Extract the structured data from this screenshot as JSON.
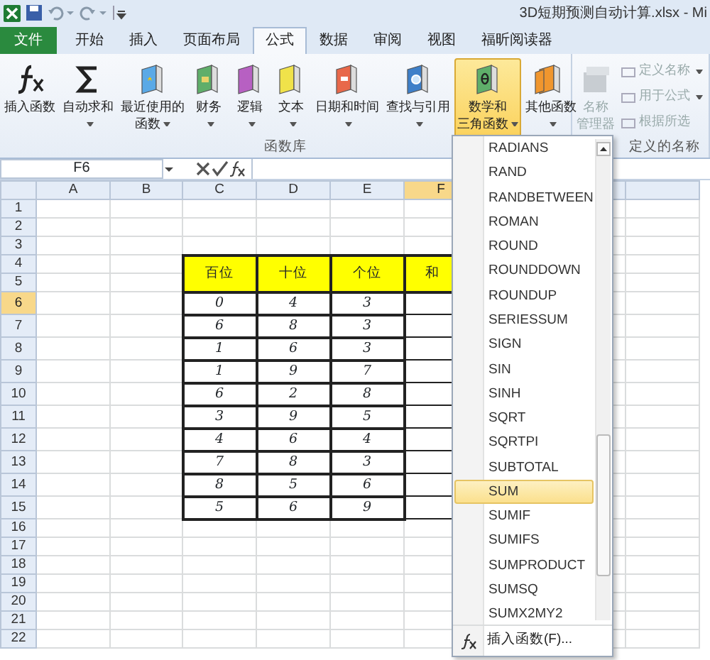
{
  "window": {
    "title": "3D短期预测自动计算.xlsx - Mi"
  },
  "tabs": [
    {
      "label": "文件",
      "kind": "file",
      "selected": false
    },
    {
      "label": "开始",
      "kind": "tab",
      "selected": false
    },
    {
      "label": "插入",
      "kind": "tab",
      "selected": false
    },
    {
      "label": "页面布局",
      "kind": "tab",
      "selected": false
    },
    {
      "label": "公式",
      "kind": "tab",
      "selected": true
    },
    {
      "label": "数据",
      "kind": "tab",
      "selected": false
    },
    {
      "label": "审阅",
      "kind": "tab",
      "selected": false
    },
    {
      "label": "视图",
      "kind": "tab",
      "selected": false
    },
    {
      "label": "福昕阅读器",
      "kind": "tab",
      "selected": false
    }
  ],
  "ribbon_groups": [
    {
      "label": "函数库",
      "buttons": [
        {
          "lines": [
            "插入函数"
          ],
          "dropdown": false,
          "selected": false,
          "disabled": false
        },
        {
          "lines": [
            "自动求和"
          ],
          "dropdown": true,
          "selected": false,
          "disabled": false
        },
        {
          "lines": [
            "最近使用的",
            "函数"
          ],
          "dropdown": true,
          "selected": false,
          "disabled": false
        },
        {
          "lines": [
            "财务"
          ],
          "dropdown": true,
          "selected": false,
          "disabled": false
        },
        {
          "lines": [
            "逻辑"
          ],
          "dropdown": true,
          "selected": false,
          "disabled": false
        },
        {
          "lines": [
            "文本"
          ],
          "dropdown": true,
          "selected": false,
          "disabled": false
        },
        {
          "lines": [
            "日期和时间"
          ],
          "dropdown": true,
          "selected": false,
          "disabled": false
        },
        {
          "lines": [
            "查找与引用"
          ],
          "dropdown": true,
          "selected": false,
          "disabled": false
        },
        {
          "lines": [
            "数学和",
            "三角函数"
          ],
          "dropdown": true,
          "selected": true,
          "disabled": false
        },
        {
          "lines": [
            "其他函数"
          ],
          "dropdown": true,
          "selected": false,
          "disabled": false
        }
      ]
    },
    {
      "label": "定义的名称",
      "buttons": [
        {
          "lines": [
            "名称",
            "管理器"
          ],
          "dropdown": false,
          "selected": false,
          "disabled": true
        }
      ],
      "small_buttons": [
        {
          "label": "定义名称",
          "dropdown": true,
          "disabled": true
        },
        {
          "label": "用于公式",
          "dropdown": true,
          "disabled": true
        },
        {
          "label": "根据所选",
          "dropdown": false,
          "disabled": true
        }
      ]
    }
  ],
  "formula_bar": {
    "name_box": "F6"
  },
  "sheet": {
    "columns": [
      {
        "label": "A",
        "selected": false
      },
      {
        "label": "B",
        "selected": false
      },
      {
        "label": "C",
        "selected": false
      },
      {
        "label": "D",
        "selected": false
      },
      {
        "label": "E",
        "selected": false
      },
      {
        "label": "F",
        "selected": true
      }
    ],
    "rows": [
      {
        "label": "1",
        "selected": false
      },
      {
        "label": "2",
        "selected": false
      },
      {
        "label": "3",
        "selected": false
      },
      {
        "label": "4",
        "selected": false
      },
      {
        "label": "5",
        "selected": false
      },
      {
        "label": "6",
        "selected": true
      },
      {
        "label": "7",
        "selected": false
      },
      {
        "label": "8",
        "selected": false
      },
      {
        "label": "9",
        "selected": false
      },
      {
        "label": "10",
        "selected": false
      },
      {
        "label": "11",
        "selected": false
      },
      {
        "label": "12",
        "selected": false
      },
      {
        "label": "13",
        "selected": false
      },
      {
        "label": "14",
        "selected": false
      },
      {
        "label": "15",
        "selected": false
      },
      {
        "label": "16",
        "selected": false
      },
      {
        "label": "17",
        "selected": false
      },
      {
        "label": "18",
        "selected": false
      },
      {
        "label": "19",
        "selected": false
      },
      {
        "label": "20",
        "selected": false
      },
      {
        "label": "21",
        "selected": false
      },
      {
        "label": "22",
        "selected": false
      }
    ],
    "table_header": [
      "百位",
      "十位",
      "个位",
      "和"
    ],
    "table_rows": [
      [
        "0",
        "4",
        "3"
      ],
      [
        "6",
        "8",
        "3"
      ],
      [
        "1",
        "6",
        "3"
      ],
      [
        "1",
        "9",
        "7"
      ],
      [
        "6",
        "2",
        "8"
      ],
      [
        "3",
        "9",
        "5"
      ],
      [
        "4",
        "6",
        "4"
      ],
      [
        "7",
        "8",
        "3"
      ],
      [
        "8",
        "5",
        "6"
      ],
      [
        "5",
        "6",
        "9"
      ]
    ]
  },
  "menu": {
    "items": [
      {
        "label": "RADIANS",
        "selected": false
      },
      {
        "label": "RAND",
        "selected": false
      },
      {
        "label": "RANDBETWEEN",
        "selected": false
      },
      {
        "label": "ROMAN",
        "selected": false
      },
      {
        "label": "ROUND",
        "selected": false
      },
      {
        "label": "ROUNDDOWN",
        "selected": false
      },
      {
        "label": "ROUNDUP",
        "selected": false
      },
      {
        "label": "SERIESSUM",
        "selected": false
      },
      {
        "label": "SIGN",
        "selected": false
      },
      {
        "label": "SIN",
        "selected": false
      },
      {
        "label": "SINH",
        "selected": false
      },
      {
        "label": "SQRT",
        "selected": false
      },
      {
        "label": "SQRTPI",
        "selected": false
      },
      {
        "label": "SUBTOTAL",
        "selected": false
      },
      {
        "label": "SUM",
        "selected": true
      },
      {
        "label": "SUMIF",
        "selected": false
      },
      {
        "label": "SUMIFS",
        "selected": false
      },
      {
        "label": "SUMPRODUCT",
        "selected": false
      },
      {
        "label": "SUMSQ",
        "selected": false
      },
      {
        "label": "SUMX2MY2",
        "selected": false
      }
    ],
    "footer": "插入函数(F)..."
  }
}
